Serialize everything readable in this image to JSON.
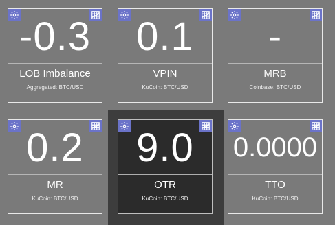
{
  "tiles": [
    {
      "value": "-0.3",
      "label": "LOB Imbalance",
      "sublabel": "Aggregated: BTC/USD"
    },
    {
      "value": "0.1",
      "label": "VPIN",
      "sublabel": "KuCoin: BTC/USD"
    },
    {
      "value": "-",
      "label": "MRB",
      "sublabel": "Coinbase: BTC/USD"
    },
    {
      "value": "0.2",
      "label": "MR",
      "sublabel": "KuCoin: BTC/USD"
    },
    {
      "value": "9.0",
      "label": "OTR",
      "sublabel": "KuCoin: BTC/USD"
    },
    {
      "value": "0.0000",
      "label": "TTO",
      "sublabel": "KuCoin: BTC/USD"
    }
  ],
  "icons": {
    "settings": "gear-icon",
    "chart": "chart-icon"
  },
  "colors": {
    "background": "#7a7a7a",
    "selected_tile": "#2b2b2b",
    "icon_button": "#6b73c9"
  }
}
